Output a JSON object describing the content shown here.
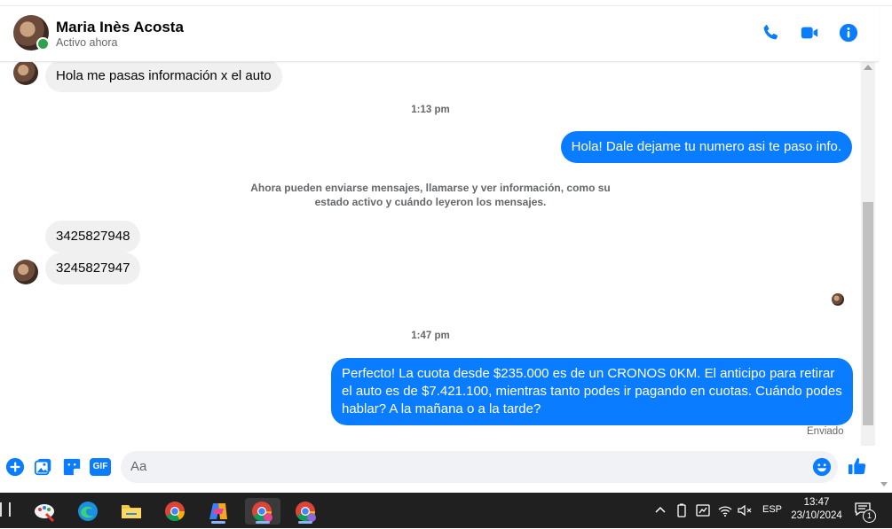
{
  "contact": {
    "name": "Maria Inès Acosta",
    "status": "Activo ahora"
  },
  "header_icons": [
    "phone-icon",
    "video-camera-icon",
    "info-icon"
  ],
  "messages": [
    {
      "type": "incoming",
      "text": "Hola me pasas información x el auto"
    },
    {
      "type": "timestamp",
      "text": "1:13 pm"
    },
    {
      "type": "outgoing",
      "text": "Hola! Dale dejame tu numero  asi te paso info."
    },
    {
      "type": "system",
      "text": "Ahora pueden enviarse mensajes, llamarse y ver información, como su estado activo y cuándo leyeron los mensajes."
    },
    {
      "type": "incoming",
      "text": "3425827948"
    },
    {
      "type": "incoming",
      "text": "3245827947"
    },
    {
      "type": "timestamp",
      "text": "1:47 pm"
    },
    {
      "type": "outgoing",
      "text": "Perfecto! La cuota desde $235.000 es de un CRONOS 0KM. El anticipo para retirar el auto es de $7.421.100, mientras tanto podes ir pagando en cuotas. Cuándo podes hablar? A la mañana o a la tarde?"
    }
  ],
  "delivery_status": "Enviado",
  "composer": {
    "placeholder": "Aa",
    "gif_label": "GIF",
    "icons": [
      "plus-icon",
      "image-icon",
      "sticker-icon",
      "gif-icon",
      "emoji-icon",
      "like-icon"
    ]
  },
  "taskbar": {
    "apps": [
      "paint-icon",
      "edge-icon",
      "file-explorer-icon",
      "chrome-icon",
      "copilot-icon",
      "chrome-profile-c-icon",
      "chrome-profile-icon"
    ],
    "language": "ESP",
    "time": "13:47",
    "date": "23/10/2024",
    "notification_count": "1"
  },
  "colors": {
    "accent": "#0a7cff",
    "incoming_bubble": "#f0f0f0",
    "online": "#31a24c",
    "taskbar": "#202020"
  }
}
